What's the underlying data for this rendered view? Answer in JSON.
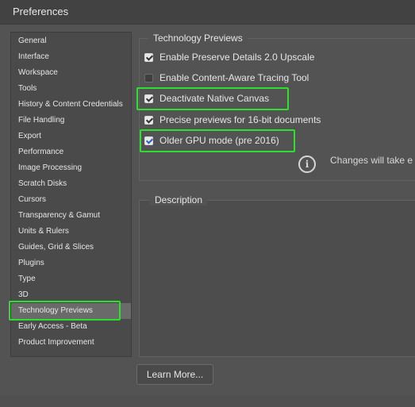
{
  "window": {
    "title": "Preferences"
  },
  "sidebar": {
    "items": [
      {
        "label": "General"
      },
      {
        "label": "Interface"
      },
      {
        "label": "Workspace"
      },
      {
        "label": "Tools"
      },
      {
        "label": "History & Content Credentials"
      },
      {
        "label": "File Handling"
      },
      {
        "label": "Export"
      },
      {
        "label": "Performance"
      },
      {
        "label": "Image Processing"
      },
      {
        "label": "Scratch Disks"
      },
      {
        "label": "Cursors"
      },
      {
        "label": "Transparency & Gamut"
      },
      {
        "label": "Units & Rulers"
      },
      {
        "label": "Guides, Grid & Slices"
      },
      {
        "label": "Plugins"
      },
      {
        "label": "Type"
      },
      {
        "label": "3D"
      },
      {
        "label": "Technology Previews",
        "selected": true
      },
      {
        "label": "Early Access - Beta"
      },
      {
        "label": "Product Improvement"
      }
    ]
  },
  "tech_previews": {
    "group_title": "Technology Previews",
    "options": [
      {
        "label": "Enable Preserve Details 2.0 Upscale",
        "checked": true
      },
      {
        "label": "Enable Content-Aware Tracing Tool",
        "checked": false
      },
      {
        "label": "Deactivate Native Canvas",
        "checked": true
      },
      {
        "label": "Precise previews for 16-bit documents",
        "checked": true
      },
      {
        "label": "Older GPU mode (pre 2016)",
        "checked": true
      }
    ],
    "info_text": "Changes will take e"
  },
  "description": {
    "title": "Description"
  },
  "buttons": {
    "learn_more": "Learn More..."
  },
  "colors": {
    "background": "#535353",
    "highlight": "#2ee02e",
    "selected_item": "#6a6a6a"
  }
}
